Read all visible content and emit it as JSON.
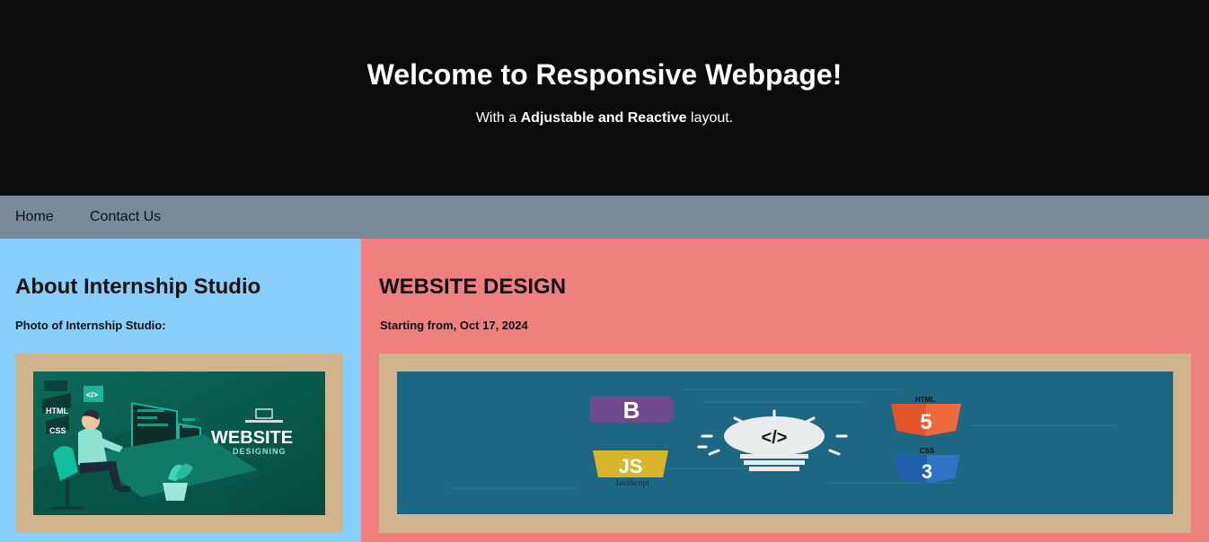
{
  "header": {
    "title": "Welcome to Responsive Webpage!",
    "subtitle_prefix": "With a ",
    "subtitle_bold": "Adjustable and Reactive",
    "subtitle_suffix": " layout."
  },
  "nav": {
    "items": [
      {
        "label": "Home"
      },
      {
        "label": "Contact Us"
      }
    ]
  },
  "sidebar": {
    "title": "About Internship Studio",
    "caption": "Photo of Internship Studio:",
    "image": {
      "headline": "WEBSITE",
      "subheadline": "DESIGNING",
      "tags": [
        "HTML",
        "CSS",
        "</>"
      ]
    }
  },
  "main": {
    "title": "WEBSITE DESIGN",
    "caption": "Starting from, Oct 17, 2024",
    "image": {
      "logos": {
        "bootstrap": "B",
        "html": "HTML",
        "css": "CSS",
        "js": "JS",
        "js_caption": "JavaScript",
        "code": "</>"
      }
    }
  },
  "colors": {
    "header_bg": "#0a0b0b",
    "nav_bg": "#788a9a",
    "sidebar_bg": "#87cefa",
    "main_bg": "#f08080",
    "frame_bg": "#d2b48c"
  }
}
